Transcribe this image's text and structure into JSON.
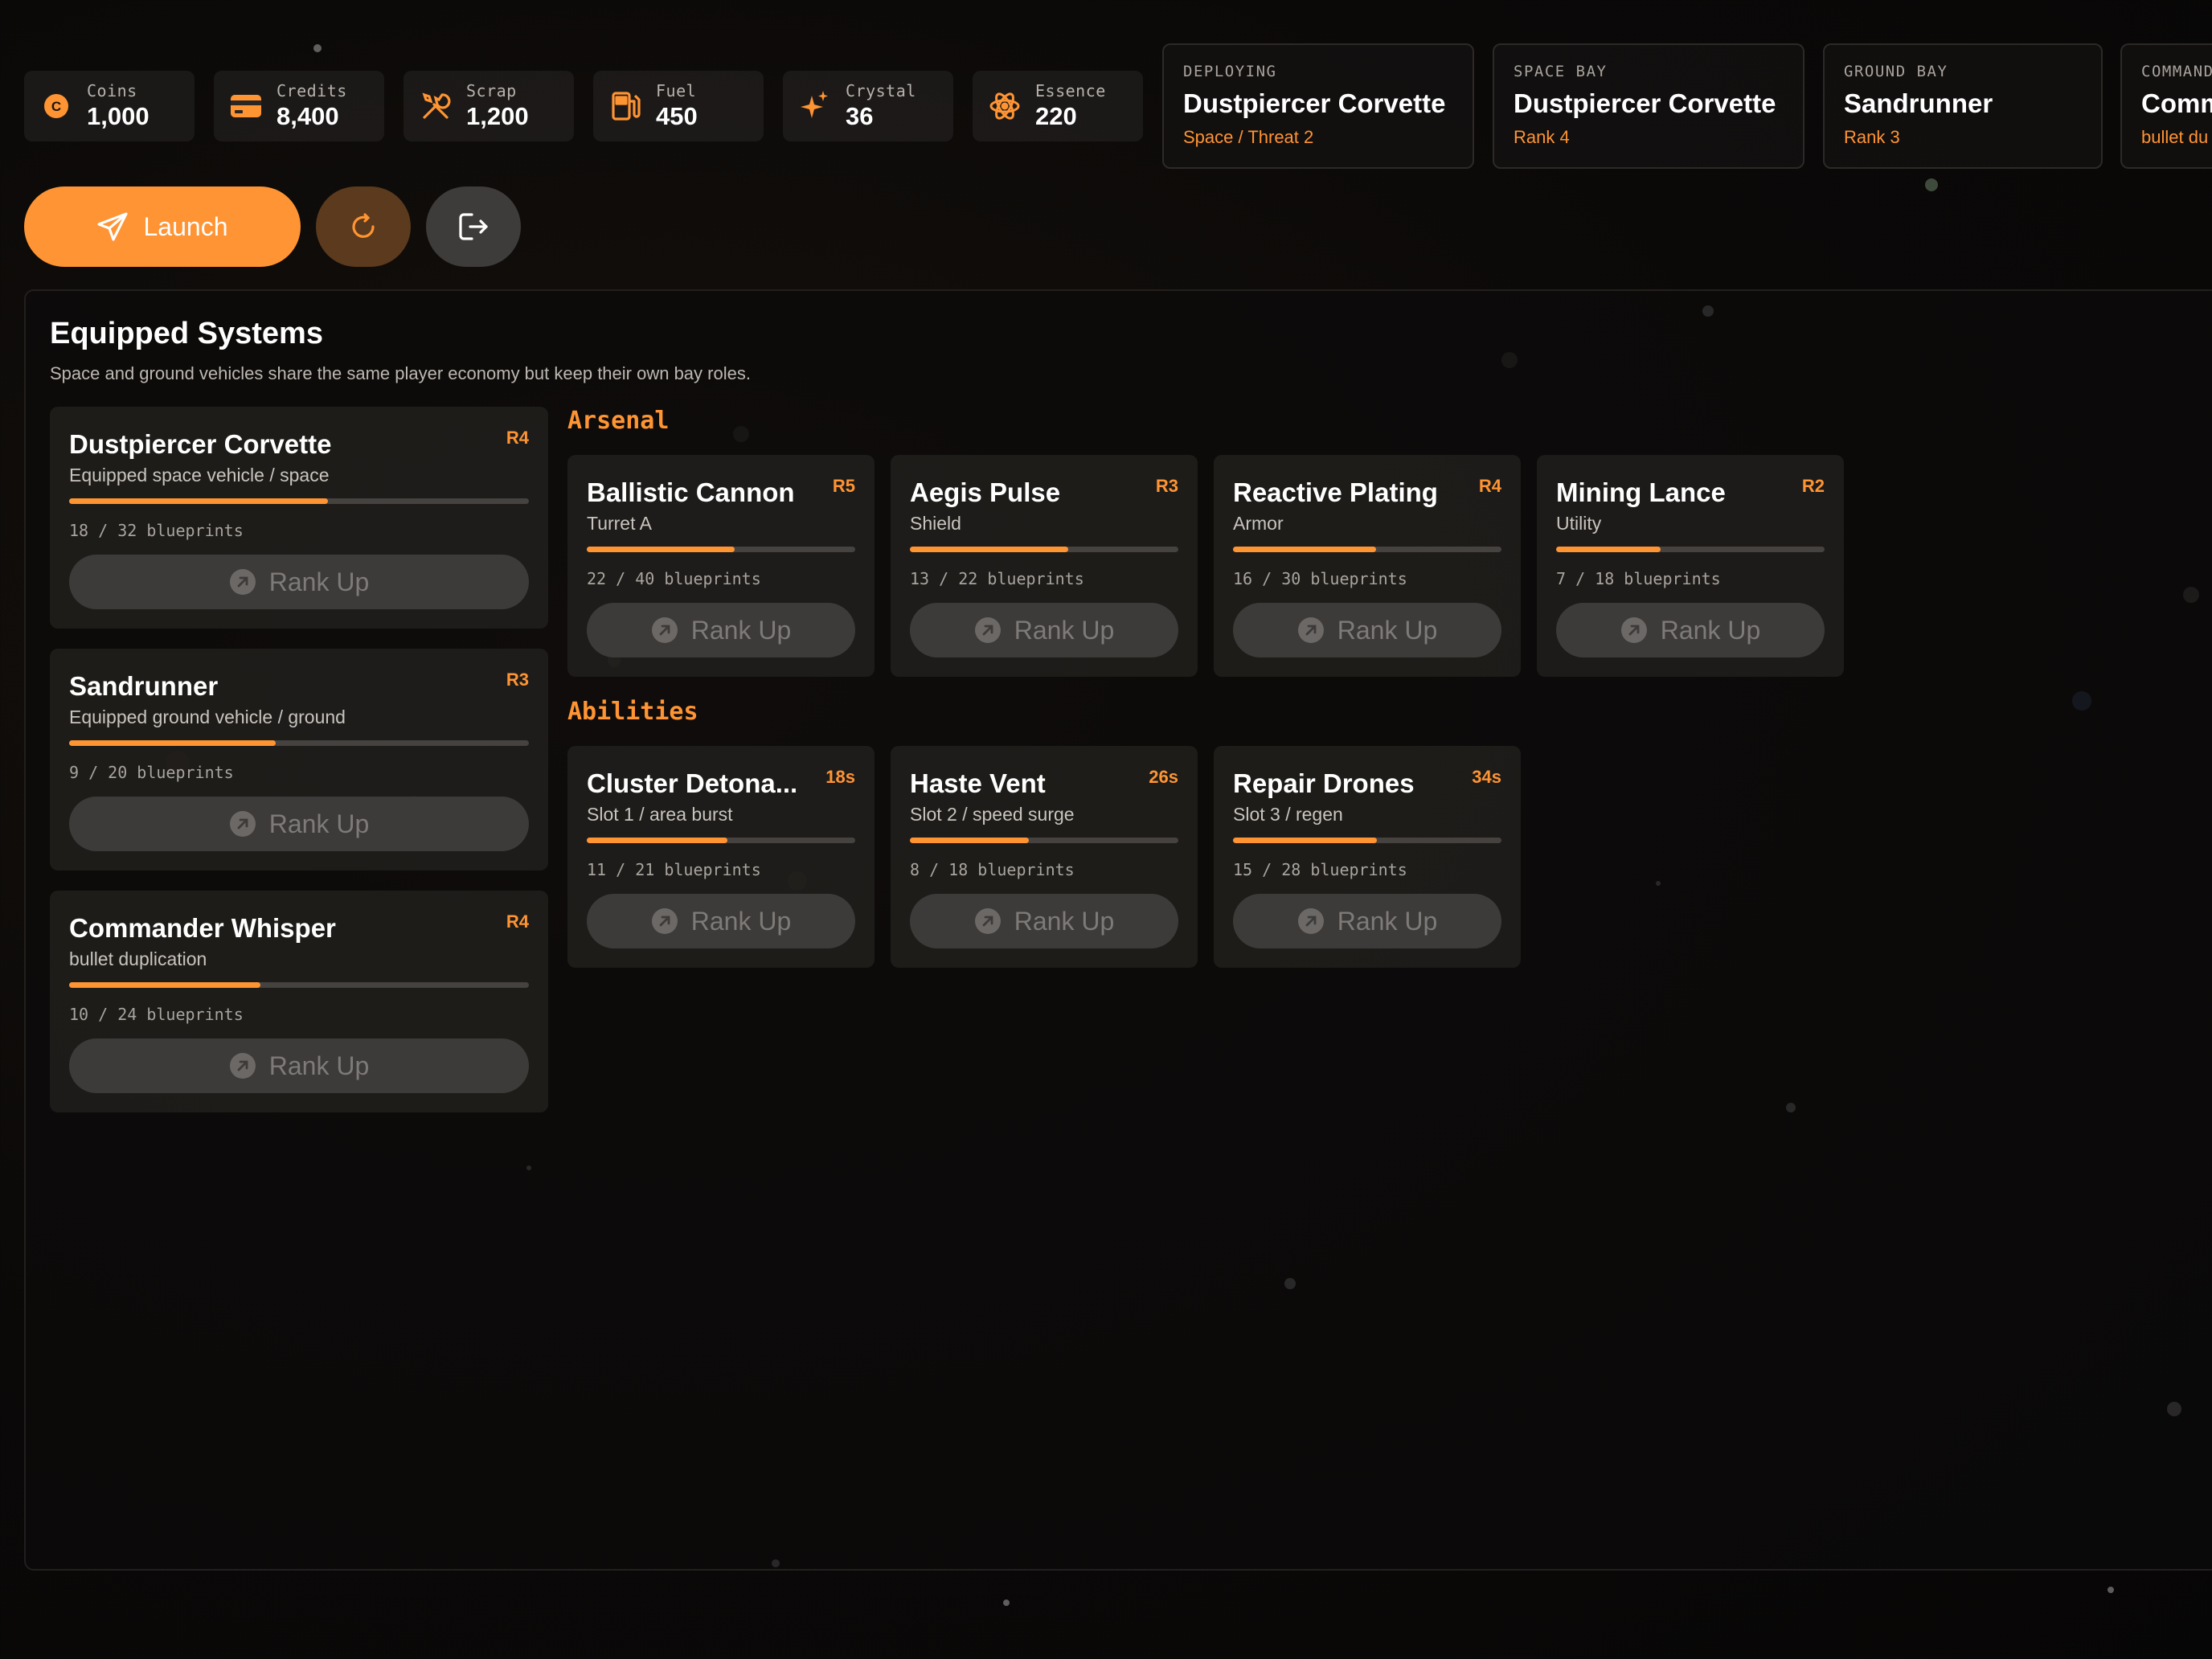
{
  "resources": [
    {
      "label": "Coins",
      "value": "1,000",
      "icon": "coin-icon"
    },
    {
      "label": "Credits",
      "value": "8,400",
      "icon": "credit-card-icon"
    },
    {
      "label": "Scrap",
      "value": "1,200",
      "icon": "tools-icon"
    },
    {
      "label": "Fuel",
      "value": "450",
      "icon": "fuel-pump-icon"
    },
    {
      "label": "Crystal",
      "value": "36",
      "icon": "sparkle-icon"
    },
    {
      "label": "Essence",
      "value": "220",
      "icon": "atom-icon"
    }
  ],
  "deploy": [
    {
      "key": "DEPLOYING",
      "title": "Dustpiercer Corvette",
      "sub": "Space / Threat 2"
    },
    {
      "key": "SPACE BAY",
      "title": "Dustpiercer Corvette",
      "sub": "Rank 4"
    },
    {
      "key": "GROUND BAY",
      "title": "Sandrunner",
      "sub": "Rank 3"
    },
    {
      "key": "COMMAND",
      "title": "Comm",
      "sub": "bullet du"
    }
  ],
  "actions": {
    "launch": "Launch",
    "refresh_icon": "refresh-icon",
    "exit_icon": "exit-icon"
  },
  "panel": {
    "title": "Equipped Systems",
    "subtitle": "Space and ground vehicles share the same player economy but keep their own bay roles."
  },
  "rank_up_label": "Rank Up",
  "vehicles": [
    {
      "name": "Dustpiercer Corvette",
      "rank": "R4",
      "sub": "Equipped space vehicle / space",
      "count": "18 / 32 blueprints",
      "progress": 0.5625
    },
    {
      "name": "Sandrunner",
      "rank": "R3",
      "sub": "Equipped ground vehicle / ground",
      "count": "9 / 20 blueprints",
      "progress": 0.45
    },
    {
      "name": "Commander Whisper",
      "rank": "R4",
      "sub": "bullet duplication",
      "count": "10 / 24 blueprints",
      "progress": 0.4167
    }
  ],
  "arsenal_label": "Arsenal",
  "arsenal": [
    {
      "name": "Ballistic Cannon",
      "rank": "R5",
      "sub": "Turret A",
      "count": "22 / 40 blueprints",
      "progress": 0.55
    },
    {
      "name": "Aegis Pulse",
      "rank": "R3",
      "sub": "Shield",
      "count": "13 / 22 blueprints",
      "progress": 0.59
    },
    {
      "name": "Reactive Plating",
      "rank": "R4",
      "sub": "Armor",
      "count": "16 / 30 blueprints",
      "progress": 0.533
    },
    {
      "name": "Mining Lance",
      "rank": "R2",
      "sub": "Utility",
      "count": "7 / 18 blueprints",
      "progress": 0.389
    }
  ],
  "abilities_label": "Abilities",
  "abilities": [
    {
      "name": "Cluster Detona...",
      "rank": "18s",
      "sub": "Slot 1 / area burst",
      "count": "11 / 21 blueprints",
      "progress": 0.524
    },
    {
      "name": "Haste Vent",
      "rank": "26s",
      "sub": "Slot 2 / speed surge",
      "count": "8 / 18 blueprints",
      "progress": 0.444
    },
    {
      "name": "Repair Drones",
      "rank": "34s",
      "sub": "Slot 3 / regen",
      "count": "15 / 28 blueprints",
      "progress": 0.536
    }
  ],
  "colors": {
    "accent": "#ff9433",
    "card": "#242220",
    "button_disabled": "#3d3b3a"
  }
}
